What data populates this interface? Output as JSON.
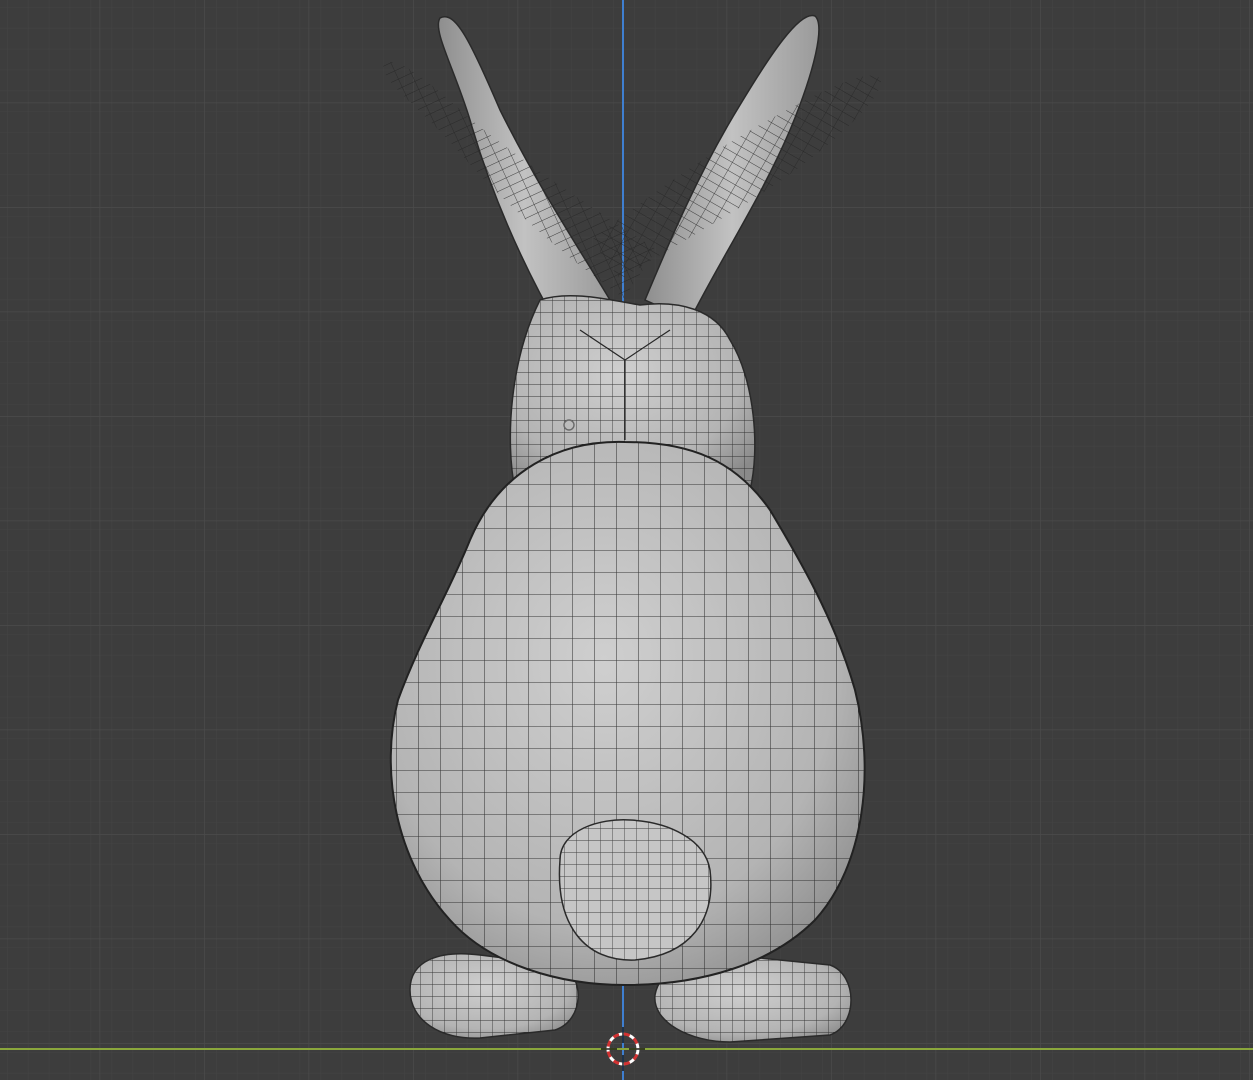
{
  "app": {
    "name": "",
    "view": "back-orthographic"
  },
  "viewport": {
    "background": "#3d3d3d",
    "grid_minor_color": "#444444",
    "grid_major_color": "#4b4b4b",
    "z_axis_color": "#3f7fd0",
    "x_axis_color": "#8aa63c",
    "mesh_fill": "#bcbcbc",
    "wire_color": "#1e1e1e"
  },
  "scene": {
    "object_type": "rabbit-mesh",
    "display_mode": "solid-with-wireframe",
    "pivot_marker": "origin-dot-icon",
    "cursor": "3d-cursor-icon"
  }
}
